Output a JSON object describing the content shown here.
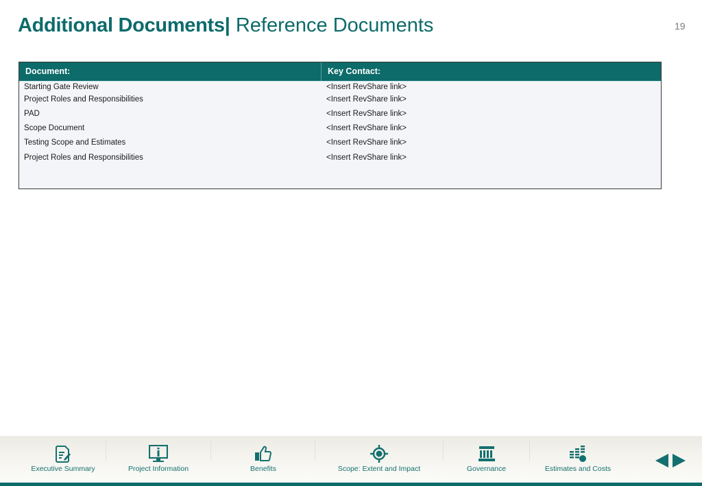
{
  "header": {
    "title_main": "Additional Documents",
    "title_sep": "|",
    "title_sub": "Reference Documents",
    "page_number": "19"
  },
  "table": {
    "columns": [
      "Document:",
      "Key Contact:"
    ],
    "rows": [
      {
        "document": "Starting Gate Review",
        "contact": "<Insert RevShare link>"
      },
      {
        "document": "Project Roles and Responsibilities",
        "contact": "<Insert RevShare link>"
      },
      {
        "document": "PAD",
        "contact": "<Insert RevShare link>"
      },
      {
        "document": "Scope Document",
        "contact": "<Insert RevShare link>"
      },
      {
        "document": "Testing Scope and Estimates",
        "contact": "<Insert RevShare link>"
      },
      {
        "document": "Project Roles and Responsibilities",
        "contact": "<Insert RevShare link>"
      }
    ]
  },
  "footer_nav": {
    "items": [
      {
        "label": "Executive Summary",
        "icon": "document-edit-icon"
      },
      {
        "label": "Project Information",
        "icon": "monitor-info-icon"
      },
      {
        "label": "Benefits",
        "icon": "thumbs-up-icon"
      },
      {
        "label": "Scope: Extent and Impact",
        "icon": "target-icon"
      },
      {
        "label": "Governance",
        "icon": "building-columns-icon"
      },
      {
        "label": "Estimates and Costs",
        "icon": "bar-stack-coin-icon"
      }
    ],
    "prev_icon": "previous-arrow-icon",
    "next_icon": "next-arrow-icon"
  },
  "colors": {
    "accent": "#0d6b6a",
    "table_bg": "#f3f5f8"
  }
}
